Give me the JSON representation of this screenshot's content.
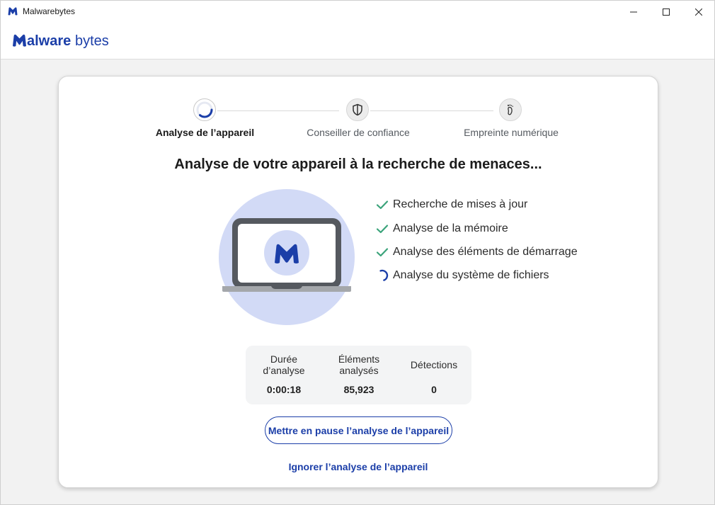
{
  "window": {
    "title": "Malwarebytes",
    "brand_color": "#1b3ea8"
  },
  "header": {
    "logo_text": "Malwarebytes"
  },
  "stepper": {
    "steps": [
      {
        "label": "Analyse de l’appareil",
        "state": "active",
        "icon": "progress-spinner-icon"
      },
      {
        "label": "Conseiller de confiance",
        "state": "inactive",
        "icon": "shield-icon"
      },
      {
        "label": "Empreinte numérique",
        "state": "inactive",
        "icon": "footprint-icon"
      }
    ]
  },
  "scan": {
    "heading": "Analyse de votre appareil à la recherche de menaces...",
    "checks": [
      {
        "label": "Recherche de mises à jour",
        "status": "done"
      },
      {
        "label": "Analyse de la mémoire",
        "status": "done"
      },
      {
        "label": "Analyse des éléments de démarrage",
        "status": "done"
      },
      {
        "label": "Analyse du système de fichiers",
        "status": "in-progress"
      }
    ],
    "check_color": "#3aa37a"
  },
  "stats": {
    "duration": {
      "label_line1": "Durée",
      "label_line2": "d’analyse",
      "value": "0:00:18"
    },
    "items": {
      "label_line1": "Éléments",
      "label_line2": "analysés",
      "value": "85,923"
    },
    "detections": {
      "label": "Détections",
      "value": "0"
    }
  },
  "actions": {
    "pause_label": "Mettre en pause l’analyse de l’appareil",
    "ignore_label": "Ignorer l’analyse de l’appareil"
  }
}
